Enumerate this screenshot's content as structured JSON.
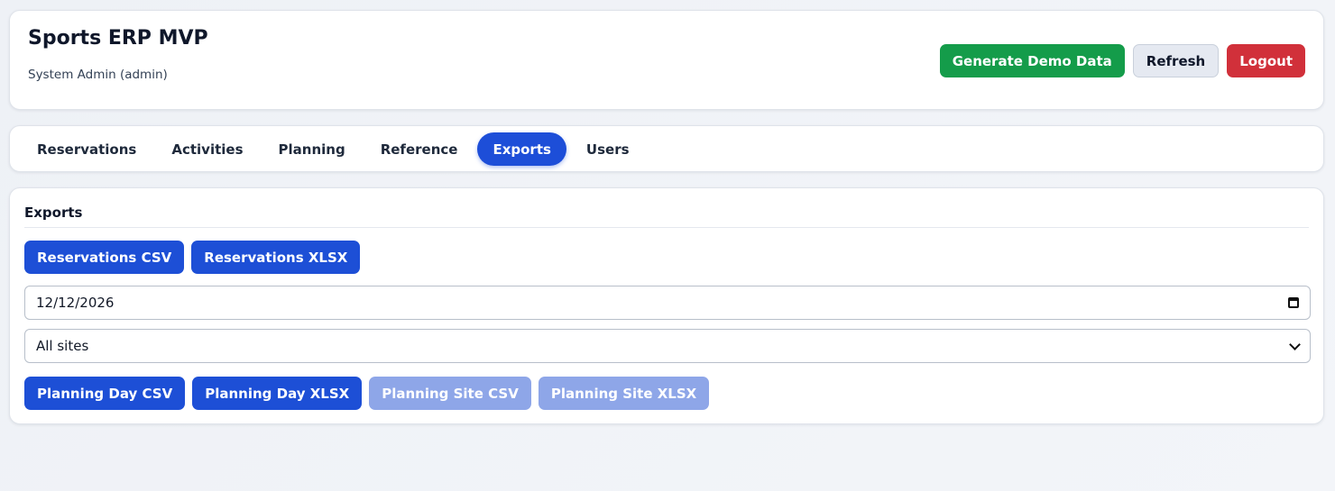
{
  "header": {
    "title": "Sports ERP MVP",
    "user": "System Admin (admin)",
    "actions": {
      "generate": "Generate Demo Data",
      "refresh": "Refresh",
      "logout": "Logout"
    }
  },
  "nav": {
    "tabs": [
      {
        "label": "Reservations"
      },
      {
        "label": "Activities"
      },
      {
        "label": "Planning"
      },
      {
        "label": "Reference"
      },
      {
        "label": "Exports",
        "active": true
      },
      {
        "label": "Users"
      }
    ]
  },
  "exports": {
    "title": "Exports",
    "reservations_csv": "Reservations CSV",
    "reservations_xlsx": "Reservations XLSX",
    "date_value": "12/12/2026",
    "site_selected": "All sites",
    "planning_day_csv": "Planning Day CSV",
    "planning_day_xlsx": "Planning Day XLSX",
    "planning_site_csv": "Planning Site CSV",
    "planning_site_xlsx": "Planning Site XLSX"
  },
  "colors": {
    "primary": "#1d4fd6",
    "success": "#149c4a",
    "danger": "#d1303a",
    "disabled": "#8ea6e8"
  },
  "icons": {
    "date_field": "calendar-icon",
    "select_field": "chevron-down-icon"
  }
}
